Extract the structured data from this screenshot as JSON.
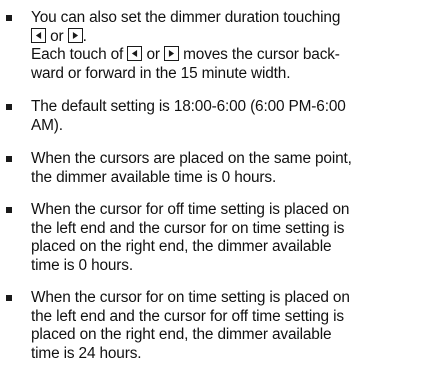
{
  "items": [
    {
      "p1": "You can also set the dimmer duration touching",
      "p2": "or",
      "p3": ".",
      "p4": "Each touch of",
      "p5": "or",
      "p6": "moves the cursor back-",
      "p7": "ward or forward in the 15 minute width."
    },
    {
      "line1": "The default setting is 18:00-6:00 (6:00 PM-6:00",
      "line2": "AM)."
    },
    {
      "line1": "When the cursors are placed on the same point,",
      "line2": "the dimmer available time is 0 hours."
    },
    {
      "line1": "When the cursor for off time setting is placed on",
      "line2": "the left end and the cursor for on time setting is",
      "line3": "placed on the right end, the dimmer available",
      "line4": "time is 0 hours."
    },
    {
      "line1": "When the cursor for on time setting is placed on",
      "line2": "the left end and the cursor for off time setting is",
      "line3": "placed on the right end, the dimmer available",
      "line4": "time is 24 hours."
    }
  ],
  "icons": {
    "left": "left-arrow-key-icon",
    "right": "right-arrow-key-icon"
  }
}
